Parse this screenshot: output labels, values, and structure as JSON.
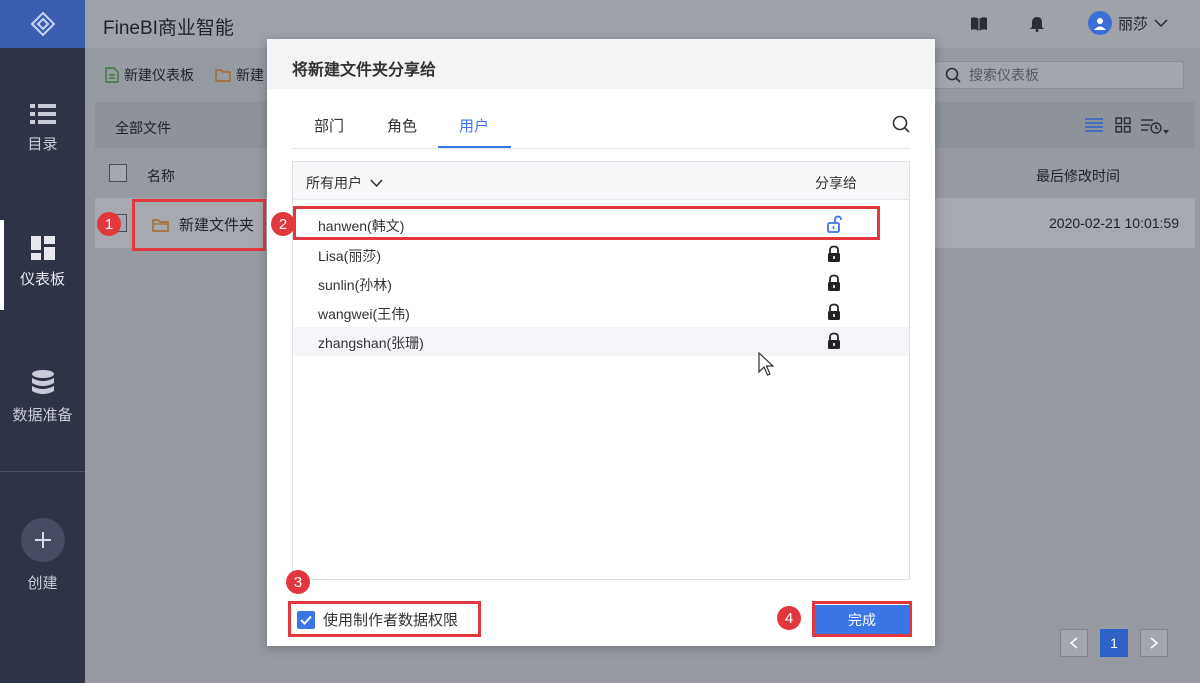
{
  "app": {
    "title": "FineBI商业智能",
    "user_name": "丽莎"
  },
  "sidebar": {
    "items": [
      {
        "label": "目录",
        "icon": "list-icon"
      },
      {
        "label": "仪表板",
        "icon": "dashboard-icon"
      },
      {
        "label": "数据准备",
        "icon": "database-icon"
      },
      {
        "label": "创建",
        "icon": "plus-icon"
      }
    ]
  },
  "toolbar": {
    "new_dashboard": "新建仪表板",
    "new_folder": "新建",
    "search_placeholder": "搜索仪表板"
  },
  "breadcrumb": "全部文件",
  "table": {
    "col_name": "名称",
    "col_modified": "最后修改时间",
    "rows": [
      {
        "name": "新建文件夹",
        "modified": "2020-02-21 10:01:59"
      }
    ]
  },
  "pager": {
    "current": "1"
  },
  "dialog": {
    "title": "将新建文件夹分享给",
    "tabs": [
      "部门",
      "角色",
      "用户"
    ],
    "active_tab": "用户",
    "list_filter": "所有用户",
    "share_col": "分享给",
    "users": [
      {
        "name": "hanwen(韩文)",
        "locked": false
      },
      {
        "name": "Lisa(丽莎)",
        "locked": true
      },
      {
        "name": "sunlin(孙林)",
        "locked": true
      },
      {
        "name": "wangwei(王伟)",
        "locked": true
      },
      {
        "name": "zhangshan(张珊)",
        "locked": true
      }
    ],
    "checkbox_label": "使用制作者数据权限",
    "checkbox_checked": true,
    "done_label": "完成"
  },
  "annotations": [
    "1",
    "2",
    "3",
    "4"
  ],
  "colors": {
    "accent": "#3a76e6",
    "annotation": "#e0383e",
    "sidebar_bg": "#2e3346"
  }
}
